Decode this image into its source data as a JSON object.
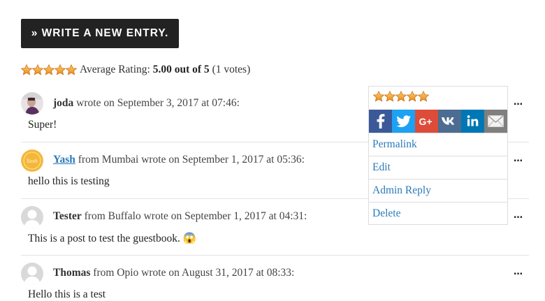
{
  "write_button": {
    "label": "» WRITE A NEW ENTRY."
  },
  "rating": {
    "label": "Average Rating:",
    "score": "5.00 out of 5",
    "votes": "(1 votes)",
    "stars_value": 5,
    "stars_max": 5
  },
  "entries": [
    {
      "author": "joda",
      "location_prefix": "",
      "location": "",
      "wrote": "wrote on September 3, 2017 at 07:46:",
      "body": "Super!",
      "dots": "…"
    },
    {
      "author": "Yash",
      "location_prefix": "from",
      "location": "Mumbai",
      "wrote": "wrote on September 1, 2017 at 05:36:",
      "body": "hello this is testing",
      "dots": "…"
    },
    {
      "author": "Tester",
      "location_prefix": "from",
      "location": "Buffalo",
      "wrote": "wrote on September 1, 2017 at 04:31:",
      "body": "This is a post to test the guestbook. 😱",
      "dots": "…"
    },
    {
      "author": "Thomas",
      "location_prefix": "from",
      "location": "Opio",
      "wrote": "wrote on August 31, 2017 at 08:33:",
      "body": "Hello this is a test",
      "dots": "…"
    }
  ],
  "popup": {
    "stars_value": 5,
    "share_icons": [
      "facebook-icon",
      "twitter-icon",
      "google-plus-icon",
      "vk-icon",
      "linkedin-icon",
      "email-icon"
    ],
    "links": [
      "Permalink",
      "Edit",
      "Admin Reply",
      "Delete"
    ]
  },
  "colors": {
    "button_bg": "#222222",
    "link": "#2a7ab9",
    "star": "#f5a623",
    "facebook": "#3b5998",
    "twitter": "#1da1f2",
    "google_plus": "#dd4b39",
    "vk": "#4c6c91",
    "linkedin": "#0077b5",
    "email": "#7f7f7f"
  }
}
